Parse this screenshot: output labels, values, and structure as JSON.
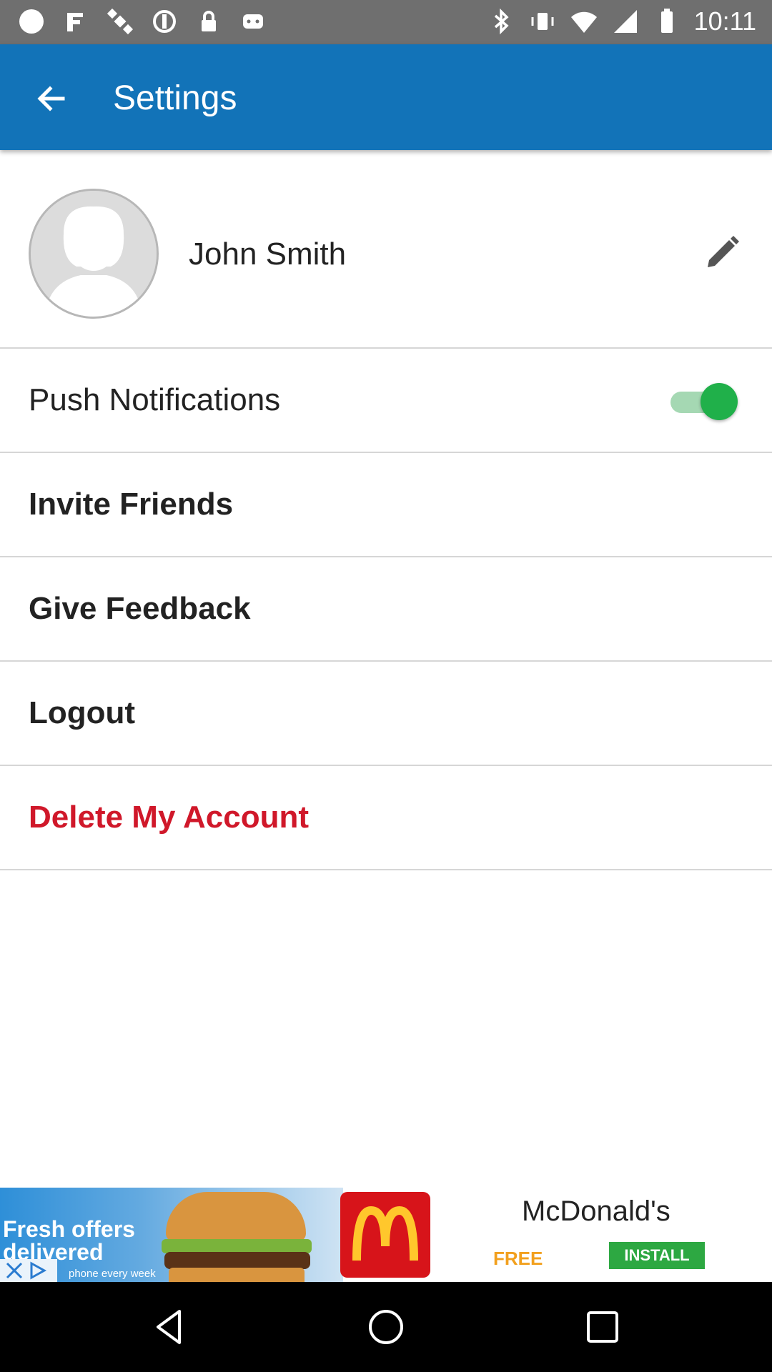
{
  "status_bar": {
    "time": "10:11",
    "left_icons": [
      "circle-icon",
      "fake-gps-icon",
      "satellite-icon",
      "sync-icon",
      "lock-icon",
      "android-icon"
    ],
    "right_icons": [
      "bluetooth-icon",
      "vibrate-icon",
      "wifi-icon",
      "signal-icon",
      "battery-icon"
    ]
  },
  "app_bar": {
    "title": "Settings",
    "back_icon": "arrow-left-icon",
    "color": "#1273b8"
  },
  "profile": {
    "name": "John Smith",
    "avatar_icon": "person-placeholder-icon",
    "edit_icon": "pencil-icon"
  },
  "settings": {
    "push_notifications": {
      "label": "Push Notifications",
      "enabled": true,
      "toggle_color": "#20b04a"
    },
    "invite_friends": {
      "label": "Invite Friends"
    },
    "give_feedback": {
      "label": "Give Feedback"
    },
    "logout": {
      "label": "Logout"
    },
    "delete_account": {
      "label": "Delete My Account",
      "color": "#d0182a"
    }
  },
  "ad": {
    "headline": "Fresh offers delivered",
    "subtext": "phone every week",
    "brand": "McDonald's",
    "price": "FREE",
    "install_label": "INSTALL"
  },
  "nav_bar": {
    "buttons": [
      "back-triangle-icon",
      "home-circle-icon",
      "recents-square-icon"
    ]
  }
}
